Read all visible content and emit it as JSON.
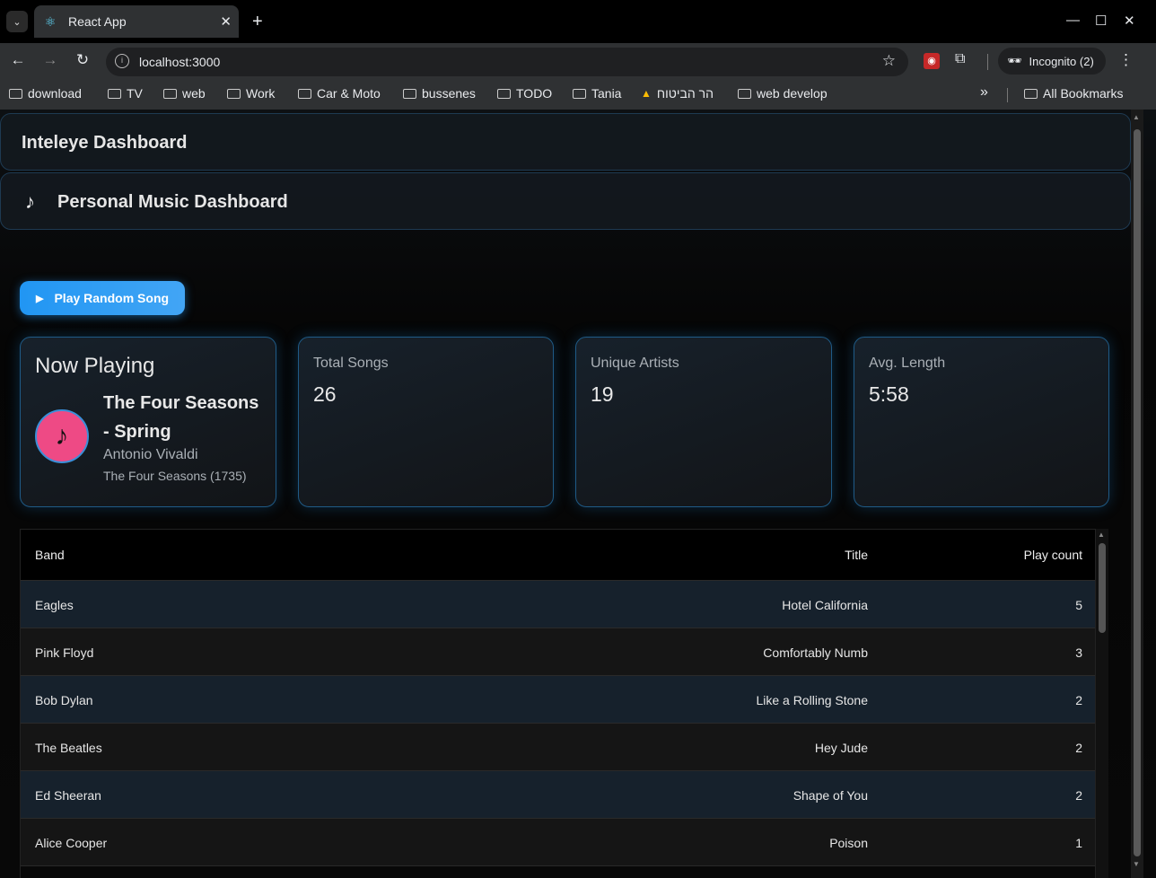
{
  "browser": {
    "tab_title": "React App",
    "url": "localhost:3000",
    "incognito_label": "Incognito (2)",
    "all_bookmarks": "All Bookmarks",
    "bookmarks": [
      "download",
      "TV",
      "web",
      "Work",
      "Car & Moto",
      "bussenes",
      "TODO",
      "Tania",
      "הר הביטוח",
      "web develop"
    ]
  },
  "header": {
    "title": "Inteleye Dashboard",
    "subtitle": "Personal Music Dashboard"
  },
  "play_button": {
    "label": "Play Random Song"
  },
  "now_playing": {
    "heading": "Now Playing",
    "song": "The Four Seasons - Spring",
    "artist": "Antonio Vivaldi",
    "album": "The Four Seasons (1735)"
  },
  "stats": [
    {
      "label": "Total Songs",
      "value": "26"
    },
    {
      "label": "Unique Artists",
      "value": "19"
    },
    {
      "label": "Avg. Length",
      "value": "5:58"
    }
  ],
  "table": {
    "columns": [
      "Band",
      "Title",
      "Play count"
    ],
    "rows": [
      {
        "band": "Eagles",
        "title": "Hotel California",
        "count": "5"
      },
      {
        "band": "Pink Floyd",
        "title": "Comfortably Numb",
        "count": "3"
      },
      {
        "band": "Bob Dylan",
        "title": "Like a Rolling Stone",
        "count": "2"
      },
      {
        "band": "The Beatles",
        "title": "Hey Jude",
        "count": "2"
      },
      {
        "band": "Ed Sheeran",
        "title": "Shape of You",
        "count": "2"
      },
      {
        "band": "Alice Cooper",
        "title": "Poison",
        "count": "1"
      }
    ]
  },
  "colors": {
    "accent": "#2196f3",
    "disc": "#ee4a85",
    "row_alt": "#16212c"
  }
}
